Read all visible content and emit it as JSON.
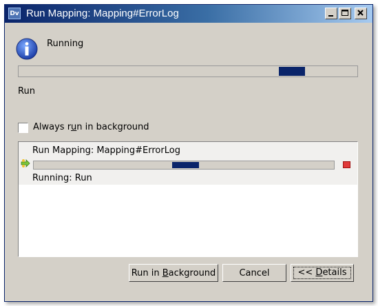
{
  "window": {
    "title": "Run Mapping: Mapping#ErrorLog",
    "app_icon_text": "Dv"
  },
  "status": {
    "label": "Running",
    "icon": "info-icon"
  },
  "task": {
    "label": "Run"
  },
  "background_option": {
    "label_pre": "Always r",
    "label_mnemonic": "u",
    "label_post": "n in background",
    "checked": false
  },
  "jobs": [
    {
      "name": "Run Mapping: Mapping#ErrorLog",
      "status": "Running: Run",
      "icon": "run-mapping-icon",
      "stop_icon": "stop-icon"
    }
  ],
  "buttons": {
    "run_bg_pre": "Run in ",
    "run_bg_mnemonic": "B",
    "run_bg_post": "ackground",
    "cancel": "Cancel",
    "details_pre": "<< ",
    "details_mnemonic": "D",
    "details_post": "etails"
  },
  "colors": {
    "title_gradient_start": "#0a246a",
    "title_gradient_end": "#a6caf0",
    "progress_fill": "#0a246a",
    "dialog_face": "#d4d0c8",
    "stop": "#e03a3a"
  }
}
